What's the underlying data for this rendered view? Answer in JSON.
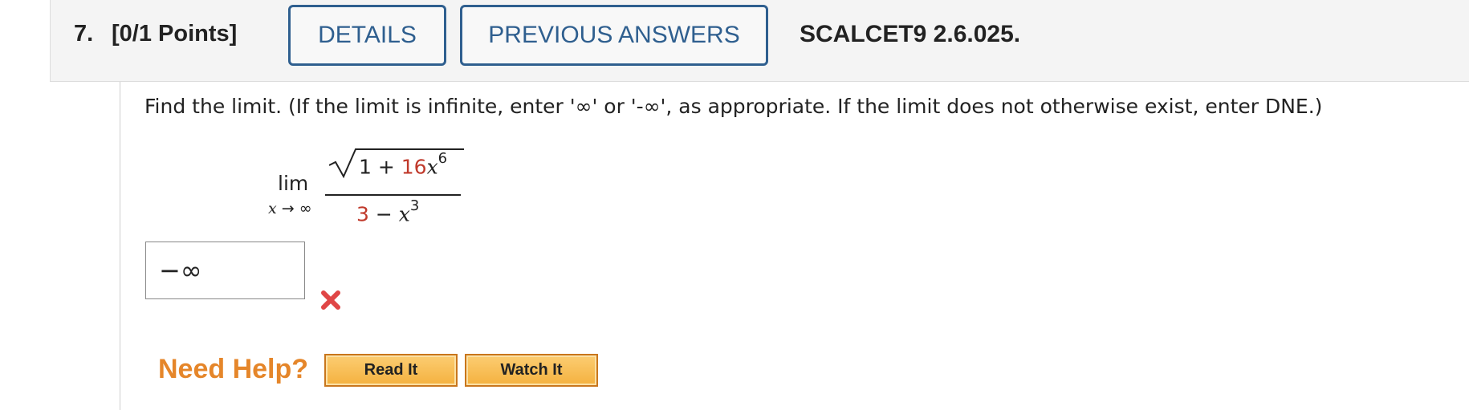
{
  "header": {
    "question_number": "7.",
    "points": "[0/1 Points]",
    "details_label": "DETAILS",
    "previous_answers_label": "PREVIOUS ANSWERS",
    "reference": "SCALCET9 2.6.025."
  },
  "question": {
    "instructions": "Find the limit. (If the limit is infinite, enter '∞' or '-∞', as appropriate. If the limit does not otherwise exist, enter DNE.)",
    "limit": {
      "lim_word": "lim",
      "variable": "x",
      "arrow": "→",
      "approaches": "∞",
      "numerator_const": "1 + ",
      "numerator_coef": "16",
      "numerator_var": "x",
      "numerator_exp": "6",
      "denominator_const": "3",
      "denominator_op": " − ",
      "denominator_var": "x",
      "denominator_exp": "3"
    },
    "answer_value": "−∞",
    "answer_status_icon": "incorrect-x-icon"
  },
  "help": {
    "need_help_label": "Need Help?",
    "read_it_label": "Read It",
    "watch_it_label": "Watch It"
  },
  "colors": {
    "accent_blue": "#2f5f8f",
    "incorrect_red": "#e04646",
    "need_help_orange": "#e5862a",
    "help_button_fill": "#f4b13f"
  }
}
